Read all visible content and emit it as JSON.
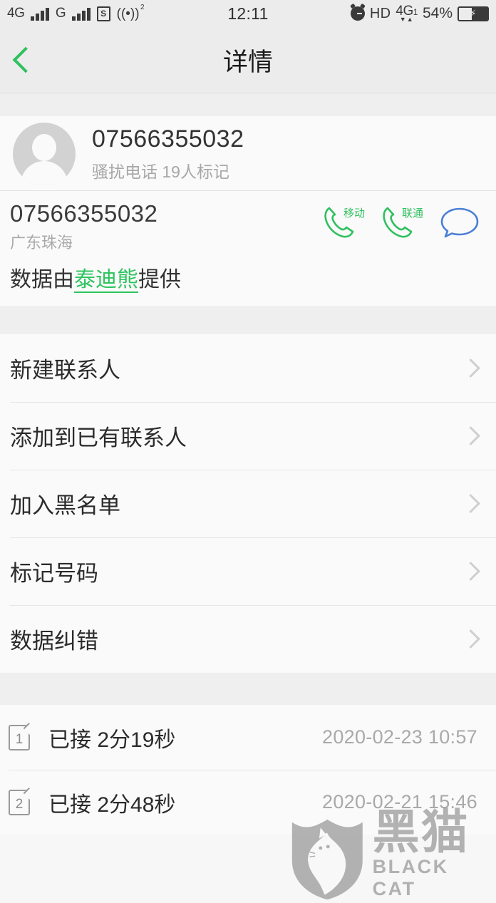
{
  "status_bar": {
    "net_primary": "4G",
    "net_secondary": "G",
    "sim_badge": "S",
    "wifi_sup": "2",
    "time": "12:11",
    "hd_label": "HD",
    "volte_label": "4G",
    "volte_sub": "1",
    "volte_arrows": "▼▲",
    "battery_pct": "54%",
    "battery_charging": "⚡"
  },
  "header": {
    "title": "详情",
    "back_label": "返回"
  },
  "contact": {
    "number": "07566355032",
    "tag": "骚扰电话 19人标记"
  },
  "number_info": {
    "number": "07566355032",
    "location": "广东珠海",
    "source_prefix": "数据由",
    "source_link": "泰迪熊",
    "source_suffix": "提供",
    "actions": [
      {
        "name": "call-mobile",
        "label": "移动",
        "color": "#2fc05f"
      },
      {
        "name": "call-unicom",
        "label": "联通",
        "color": "#2fc05f"
      },
      {
        "name": "send-message",
        "label": "",
        "color": "#4a7fd6"
      }
    ]
  },
  "menu": {
    "items": [
      {
        "label": "新建联系人"
      },
      {
        "label": "添加到已有联系人"
      },
      {
        "label": "加入黑名单"
      },
      {
        "label": "标记号码"
      },
      {
        "label": "数据纠错"
      }
    ]
  },
  "call_log": {
    "items": [
      {
        "sim": "1",
        "text": "已接 2分19秒",
        "date": "2020-02-23 10:57"
      },
      {
        "sim": "2",
        "text": "已接 2分48秒",
        "date": "2020-02-21 15:46"
      }
    ]
  },
  "watermark": {
    "cn": "黑猫",
    "en": "BLACK CAT"
  },
  "colors": {
    "accent_green": "#2ec45f",
    "message_blue": "#4a7fd6",
    "header_bg": "#ececec",
    "page_bg": "#efefef",
    "card_bg": "#fafafa"
  }
}
